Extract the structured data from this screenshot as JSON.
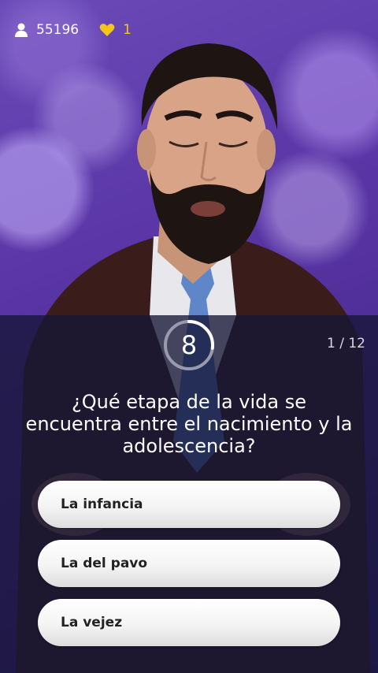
{
  "status": {
    "players": "55196",
    "lives": "1"
  },
  "timer": {
    "seconds": "8",
    "remaining_fraction": 0.27
  },
  "progress": "1 / 12",
  "question": "¿Qué etapa de la vida se encuentra entre el nacimiento y la adolescencia?",
  "answers": [
    "La infancia",
    "La del pavo",
    "La vejez"
  ],
  "colors": {
    "overlay": "#161636",
    "accent_heart": "#f5c518",
    "background_purple": "#5a36a6"
  }
}
